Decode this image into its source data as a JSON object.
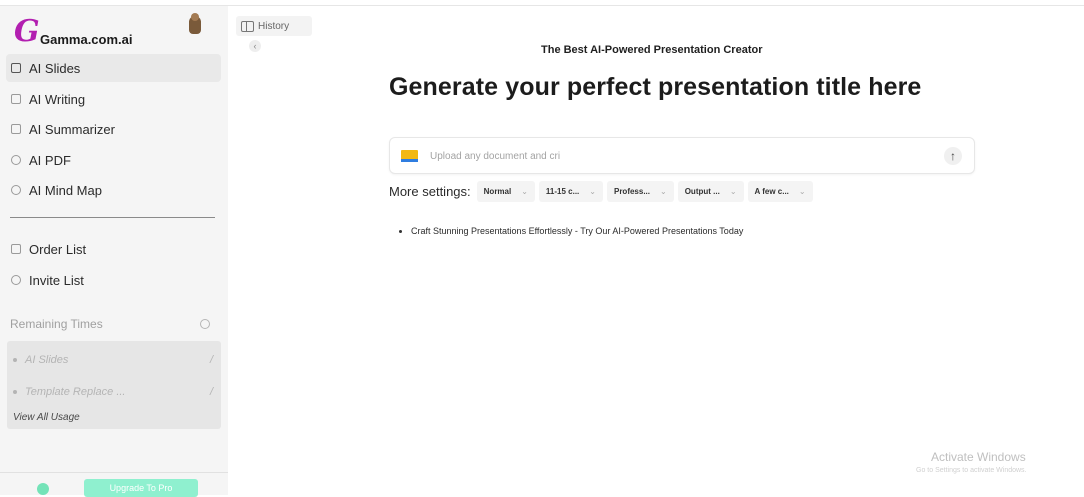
{
  "brand": {
    "letter": "G",
    "name": "Gamma.com.ai"
  },
  "sidebar": {
    "items": [
      {
        "label": "AI Slides",
        "icon": "slides-icon",
        "active": true
      },
      {
        "label": "AI Writing",
        "icon": "writing-icon"
      },
      {
        "label": "AI Summarizer",
        "icon": "summarizer-icon"
      },
      {
        "label": "AI PDF",
        "icon": "pdf-icon"
      },
      {
        "label": "AI Mind Map",
        "icon": "mind-map-icon"
      }
    ],
    "lists": [
      {
        "label": "Order List",
        "icon": "order-list-icon"
      },
      {
        "label": "Invite List",
        "icon": "user-icon"
      }
    ],
    "remaining": {
      "title": "Remaining Times",
      "rows": [
        {
          "label": "AI Slides",
          "count": "/"
        },
        {
          "label": "Template Replace ...",
          "count": "/"
        }
      ],
      "view_all": "View All Usage"
    },
    "upgrade_label": "Upgrade To Pro"
  },
  "history": {
    "label": "History",
    "collapse": "‹"
  },
  "main": {
    "subtitle": "The Best AI-Powered Presentation Creator",
    "headline": "Generate your perfect presentation title here",
    "upload_placeholder": "Upload any document and cri",
    "send_icon": "↑",
    "settings_label": "More settings:",
    "settings": [
      "Normal",
      "11-15 c...",
      "Profess...",
      "Output ...",
      "A few c..."
    ],
    "promo": "Craft Stunning Presentations Effortlessly - Try Our AI-Powered Presentations Today"
  },
  "watermark": {
    "title": "Activate Windows",
    "sub": "Go to Settings to activate Windows."
  },
  "colors": {
    "brand": "#b21fb0",
    "upgrade": "#8ff0cf",
    "folder": "#f2b814"
  }
}
